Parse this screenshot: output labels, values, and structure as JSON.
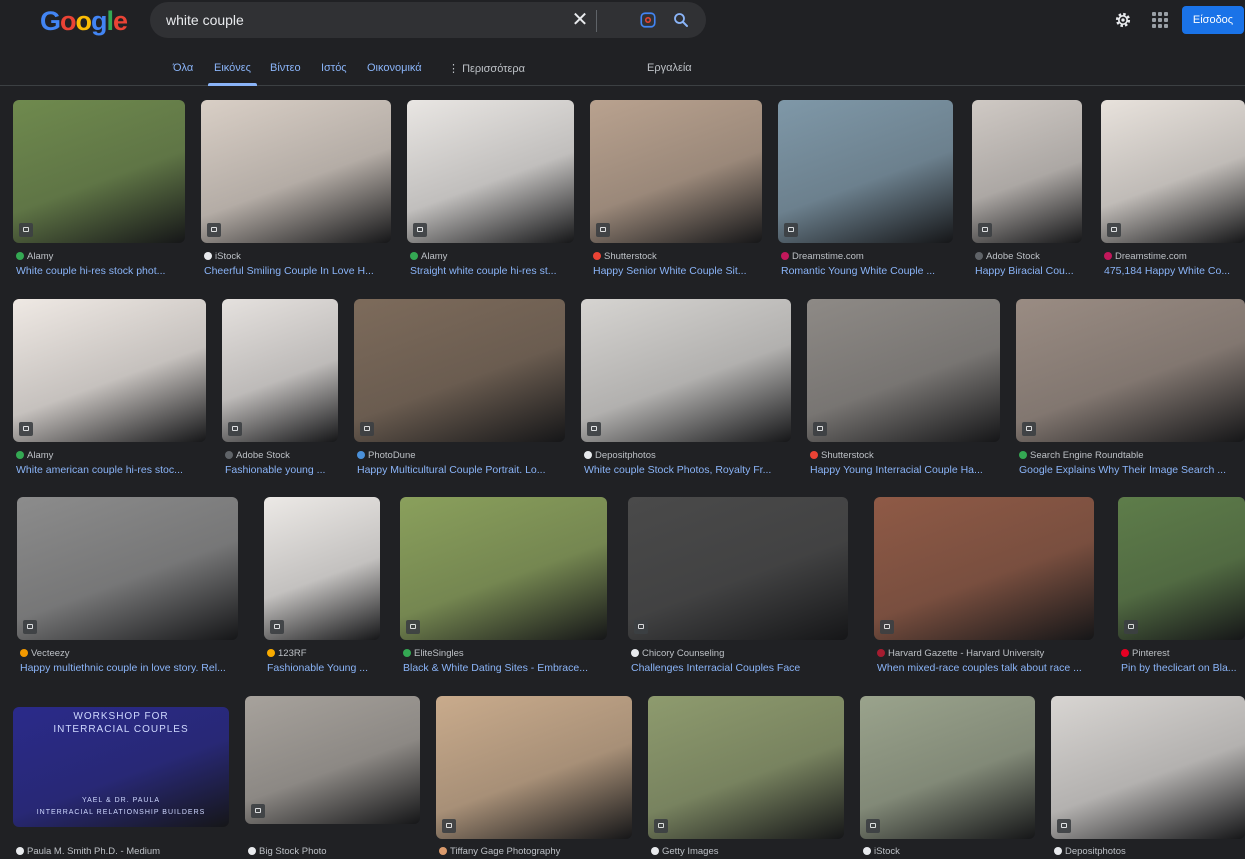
{
  "brand": {
    "name": "Google",
    "colors": [
      "#4285f4",
      "#ea4335",
      "#fbbc05",
      "#4285f4",
      "#34a853",
      "#ea4335"
    ]
  },
  "search": {
    "query": "white couple"
  },
  "header": {
    "signin_label": "Είσοδος"
  },
  "tabs": [
    {
      "label": "Όλα"
    },
    {
      "label": "Εικόνες"
    },
    {
      "label": "Βίντεο"
    },
    {
      "label": "Ιστός"
    },
    {
      "label": "Οικονομικά"
    },
    {
      "label": "Περισσότερα"
    },
    {
      "label": "Εργαλεία"
    }
  ],
  "results": [
    {
      "source": "Alamy",
      "title": "White couple hi-res stock phot...",
      "color": "#34a853",
      "bg": "#6f8a4e"
    },
    {
      "source": "iStock",
      "title": "Cheerful Smiling Couple In Love H...",
      "color": "#e8eaed",
      "bg": "#d9cfc6"
    },
    {
      "source": "Alamy",
      "title": "Straight white couple hi-res st...",
      "color": "#34a853",
      "bg": "#e9e6e3"
    },
    {
      "source": "Shutterstock",
      "title": "Happy Senior White Couple Sit...",
      "color": "#ea4335",
      "bg": "#b9a28f"
    },
    {
      "source": "Dreamstime.com",
      "title": "Romantic Young White Couple ...",
      "color": "#c2185b",
      "bg": "#7f98a8"
    },
    {
      "source": "Adobe Stock",
      "title": "Happy Biracial Cou...",
      "color": "#5f6368",
      "bg": "#cfc9c4"
    },
    {
      "source": "Dreamstime.com",
      "title": "475,184 Happy White Co...",
      "color": "#c2185b",
      "bg": "#e8e2dc"
    },
    {
      "source": "Alamy",
      "title": "White american couple hi-res stoc...",
      "color": "#34a853",
      "bg": "#efe9e4"
    },
    {
      "source": "Adobe Stock",
      "title": "Fashionable young ...",
      "color": "#5f6368",
      "bg": "#e5e1de"
    },
    {
      "source": "PhotoDune",
      "title": "Happy Multicultural Couple Portrait. Lo...",
      "color": "#4a90d9",
      "bg": "#7d6b5b"
    },
    {
      "source": "Depositphotos",
      "title": "White couple Stock Photos, Royalty Fr...",
      "color": "#e8eaed",
      "bg": "#d6d4d1"
    },
    {
      "source": "Shutterstock",
      "title": "Happy Young Interracial Couple Ha...",
      "color": "#ea4335",
      "bg": "#8e8a86"
    },
    {
      "source": "Search Engine Roundtable",
      "title": "Google Explains Why Their Image Search ...",
      "color": "#34a853",
      "bg": "#9a8c83"
    },
    {
      "source": "Vecteezy",
      "title": "Happy multiethnic couple in love story. Rel...",
      "color": "#f29900",
      "bg": "#8c8c8c"
    },
    {
      "source": "123RF",
      "title": "Fashionable Young ...",
      "color": "#f9ab00",
      "bg": "#ece9e6"
    },
    {
      "source": "EliteSingles",
      "title": "Black & White Dating Sites - Embrace...",
      "color": "#34a853",
      "bg": "#8aa05c"
    },
    {
      "source": "Chicory Counseling",
      "title": "Challenges Interracial Couples Face",
      "color": "#e8eaed",
      "bg": "#4a4a4a"
    },
    {
      "source": "Harvard Gazette - Harvard University",
      "title": "When mixed-race couples talk about race ...",
      "color": "#a51c30",
      "bg": "#8f5a46"
    },
    {
      "source": "Pinterest",
      "title": "Pin by theclicart on Bla...",
      "color": "#e60023",
      "bg": "#5e7d4a"
    },
    {
      "source": "Paula M. Smith Ph.D. - Medium",
      "title": "",
      "color": "#e8eaed",
      "bg": "#2a2a8a",
      "overlay": [
        "WORKSHOP FOR",
        "INTERRACIAL COUPLES",
        "YAEL & DR. PAULA",
        "INTERRACIAL RELATIONSHIP BUILDERS"
      ]
    },
    {
      "source": "Big Stock Photo",
      "title": "",
      "color": "#e8eaed",
      "bg": "#a7a29c"
    },
    {
      "source": "Tiffany Gage Photography",
      "title": "",
      "color": "#d99a6c",
      "bg": "#c9ab8c"
    },
    {
      "source": "Getty Images",
      "title": "",
      "color": "#e8eaed",
      "bg": "#8e9b6e"
    },
    {
      "source": "iStock",
      "title": "",
      "color": "#e8eaed",
      "bg": "#9aa38c"
    },
    {
      "source": "Depositphotos",
      "title": "",
      "color": "#e8eaed",
      "bg": "#d8d5d2"
    }
  ]
}
